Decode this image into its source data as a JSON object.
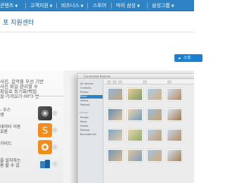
{
  "nav": {
    "items": [
      {
        "label": "콘텐츠"
      },
      {
        "label": "고객지원"
      },
      {
        "label": "비즈니스"
      },
      {
        "label": "스토어"
      },
      {
        "label": "마이 삼성"
      },
      {
        "label": "삼성그룹"
      }
    ]
  },
  "page": {
    "title": "포 지원센터"
  },
  "store_button": {
    "label": "스토"
  },
  "promo": {
    "lines": [
      "",
      "사진, 음악을 무선 기반",
      "사진 파일 관리할 수",
      "파일로 동기화/백업",
      "을 가져오기 MP3 변"
    ],
    "features": [
      {
        "text": "- 우스\n생",
        "color": "#4a4a4a"
      },
      {
        "text": "데이터 이동\n호환",
        "color": "#f28c1c"
      },
      {
        "text": "가이드",
        "color": "#f28c1c"
      },
      {
        "text": "을 설치하는\n용 할 수 있",
        "color": "#2d83c4"
      }
    ]
  },
  "app": {
    "window_title": "Connected devices",
    "library_heading": "Library",
    "sidebar_items": [
      "All devices",
      "Contacts",
      "Photos",
      "Music",
      "Videos",
      "Podcast"
    ],
    "library_items": [
      "Photos",
      "Music",
      "Videos",
      "Podcast",
      "Recorded list"
    ],
    "active_index": 3
  },
  "colors": {
    "nav_bg": "#2d83c4",
    "accent": "#1c7fd0",
    "title_text": "#1a5fa0"
  }
}
